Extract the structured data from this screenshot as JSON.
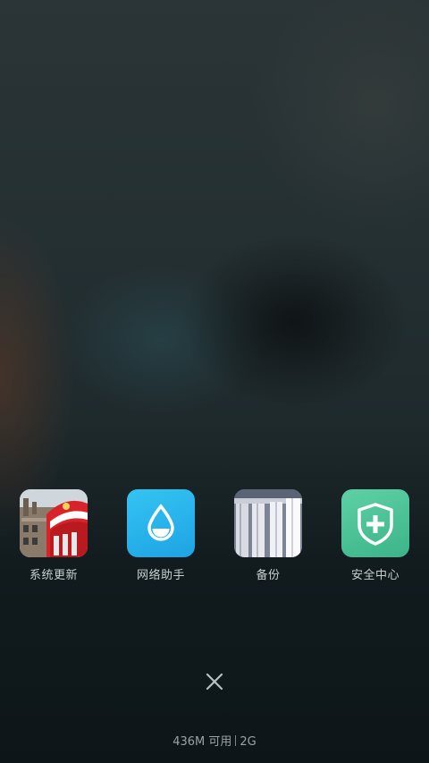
{
  "apps": [
    {
      "label": "系统更新",
      "icon": "telephone-booth-photo-icon"
    },
    {
      "label": "网络助手",
      "icon": "water-drop-icon"
    },
    {
      "label": "备份",
      "icon": "columns-photo-icon"
    },
    {
      "label": "安全中心",
      "icon": "shield-plus-icon"
    }
  ],
  "close_icon": "close-icon",
  "status": {
    "memory": "436M 可用",
    "network": "2G"
  },
  "colors": {
    "label_text": "#c9cfd0",
    "status_text": "#9aa3a5",
    "network_tile": "#2bb5ec",
    "security_tile": "#4cc296",
    "booth_red": "#d8232a"
  }
}
